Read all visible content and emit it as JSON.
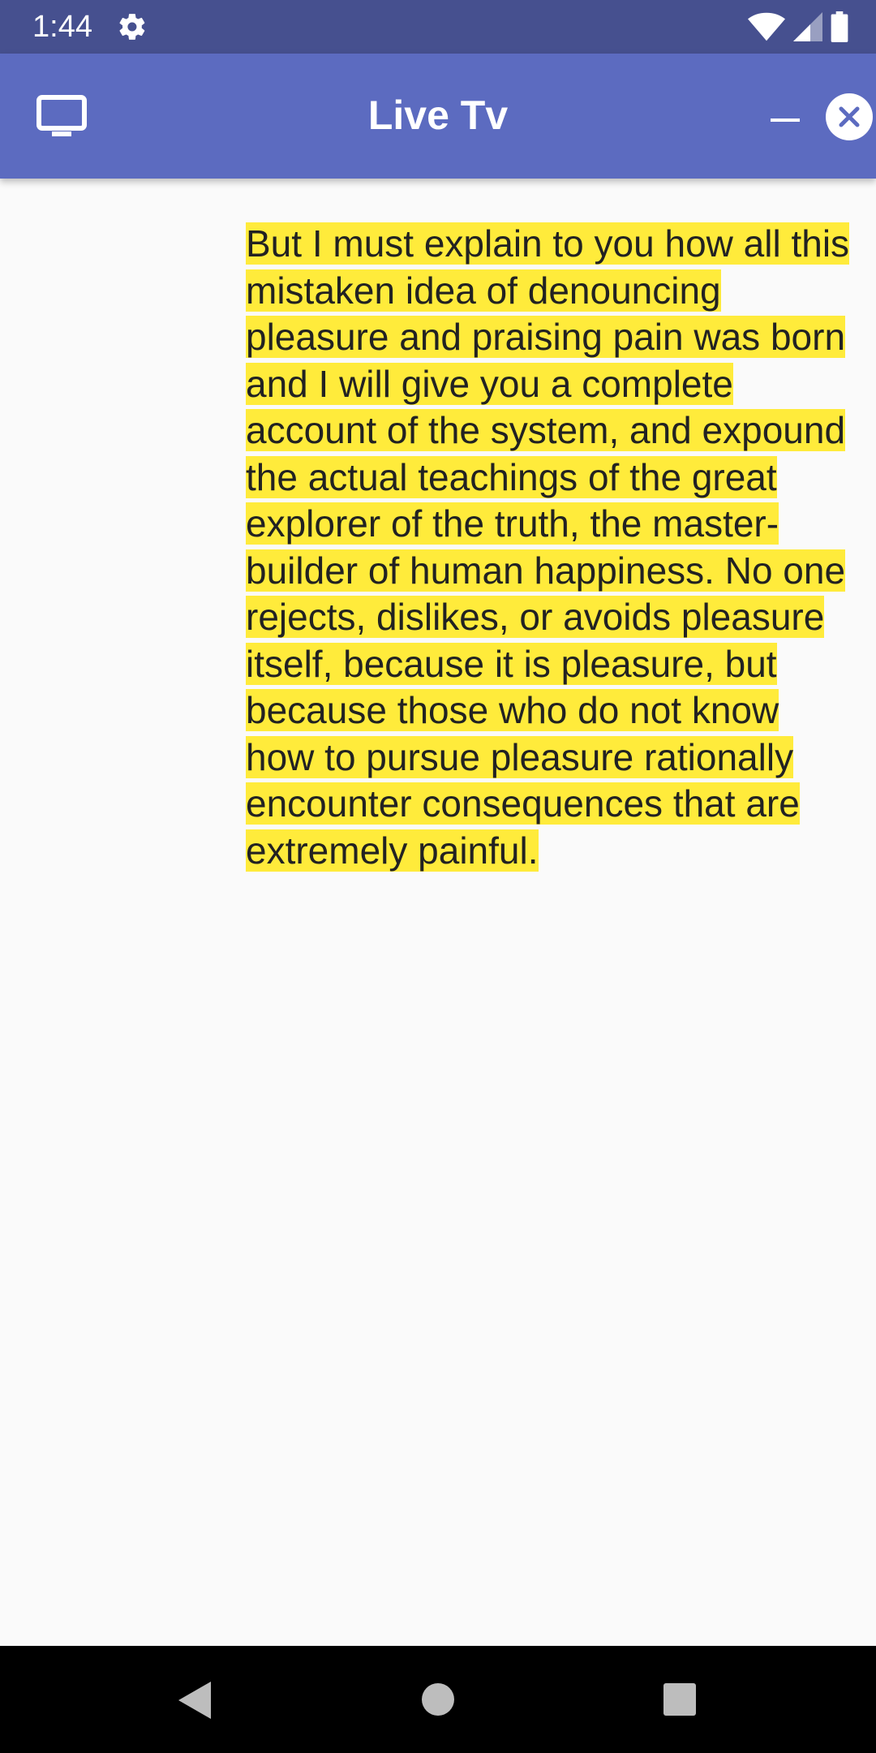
{
  "status_bar": {
    "time": "1:44",
    "icons": [
      "gear-icon",
      "wifi-icon",
      "cell-signal-icon",
      "battery-icon"
    ]
  },
  "app_bar": {
    "title": "Live Tv",
    "left_icon": "tv-icon",
    "right_icons": [
      "minimize-icon",
      "close-icon"
    ]
  },
  "content": {
    "text": "But I must explain to you how all this mistaken idea of denouncing pleasure and praising pain was born and I will give you a complete account of the system, and expound the actual teachings of the great explorer of the truth, the master-builder of human happiness. No one rejects, dislikes, or avoids pleasure itself, because it is pleasure, but because those who do not know how to pursue pleasure rationally encounter consequences that are extremely painful.",
    "highlight_color": "#ffeb3b"
  },
  "nav_bar": {
    "buttons": [
      "back-icon",
      "home-icon",
      "recents-icon"
    ]
  },
  "colors": {
    "status_bar": "#46508f",
    "app_bar": "#5c6bc0",
    "background": "#fafafa"
  }
}
